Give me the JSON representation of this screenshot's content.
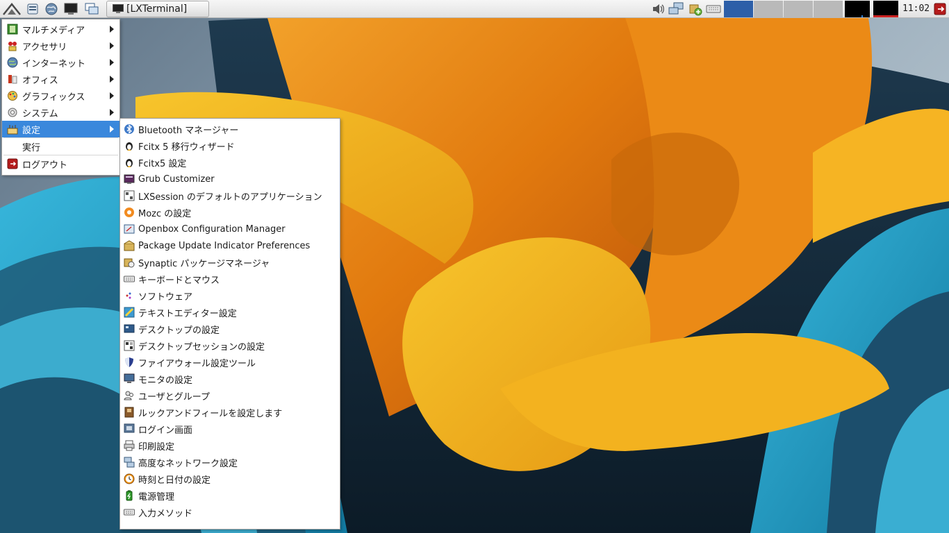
{
  "panel": {
    "task_label": "[LXTerminal]",
    "clock": "11:02",
    "launchers": [
      "lxde-menu-icon",
      "file-manager-icon",
      "web-browser-icon",
      "terminal-icon",
      "window-switch-icon"
    ],
    "tray_icons": [
      "volume-icon",
      "network-icon",
      "update-icon",
      "keyboard-icon"
    ],
    "workspaces": 4,
    "active_workspace": 1,
    "colors": {
      "active_workspace": "#2d5fa8",
      "inactive_workspace": "#b9b9b9",
      "menu_highlight": "#3a88dc"
    }
  },
  "main_menu": {
    "items": [
      {
        "label": "マルチメディア",
        "icon": "multimedia-icon",
        "submenu": true
      },
      {
        "label": "アクセサリ",
        "icon": "accessories-icon",
        "submenu": true
      },
      {
        "label": "インターネット",
        "icon": "internet-icon",
        "submenu": true
      },
      {
        "label": "オフィス",
        "icon": "office-icon",
        "submenu": true
      },
      {
        "label": "グラフィックス",
        "icon": "graphics-icon",
        "submenu": true
      },
      {
        "label": "システム",
        "icon": "system-icon",
        "submenu": true
      },
      {
        "label": "設定",
        "icon": "settings-icon",
        "submenu": true,
        "active": true
      }
    ],
    "run_label": "実行",
    "logout_label": "ログアウト"
  },
  "settings_menu": {
    "items": [
      {
        "label": "Bluetooth マネージャー",
        "icon": "bluetooth-icon"
      },
      {
        "label": "Fcitx 5 移行ウィザード",
        "icon": "fcitx-penguin-icon"
      },
      {
        "label": "Fcitx5 設定",
        "icon": "fcitx-penguin-icon"
      },
      {
        "label": "Grub Customizer",
        "icon": "grub-icon"
      },
      {
        "label": "LXSession のデフォルトのアプリケーション",
        "icon": "lxsession-icon"
      },
      {
        "label": "Mozc の設定",
        "icon": "mozc-icon"
      },
      {
        "label": "Openbox Configuration Manager",
        "icon": "openbox-icon"
      },
      {
        "label": "Package Update Indicator Preferences",
        "icon": "package-icon"
      },
      {
        "label": "Synaptic パッケージマネージャ",
        "icon": "synaptic-icon"
      },
      {
        "label": "キーボードとマウス",
        "icon": "keyboard-icon"
      },
      {
        "label": "ソフトウェア",
        "icon": "software-icon"
      },
      {
        "label": "テキストエディター設定",
        "icon": "text-editor-icon"
      },
      {
        "label": "デスクトップの設定",
        "icon": "desktop-icon"
      },
      {
        "label": "デスクトップセッションの設定",
        "icon": "session-icon"
      },
      {
        "label": "ファイアウォール設定ツール",
        "icon": "firewall-shield-icon"
      },
      {
        "label": "モニタの設定",
        "icon": "monitor-icon"
      },
      {
        "label": "ユーザとグループ",
        "icon": "users-icon"
      },
      {
        "label": "ルックアンドフィールを設定します",
        "icon": "appearance-icon"
      },
      {
        "label": "ログイン画面",
        "icon": "login-screen-icon"
      },
      {
        "label": "印刷設定",
        "icon": "printer-icon"
      },
      {
        "label": "高度なネットワーク設定",
        "icon": "network-icon"
      },
      {
        "label": "時刻と日付の設定",
        "icon": "clock-icon"
      },
      {
        "label": "電源管理",
        "icon": "battery-icon"
      },
      {
        "label": "入力メソッド",
        "icon": "input-method-icon"
      }
    ]
  }
}
